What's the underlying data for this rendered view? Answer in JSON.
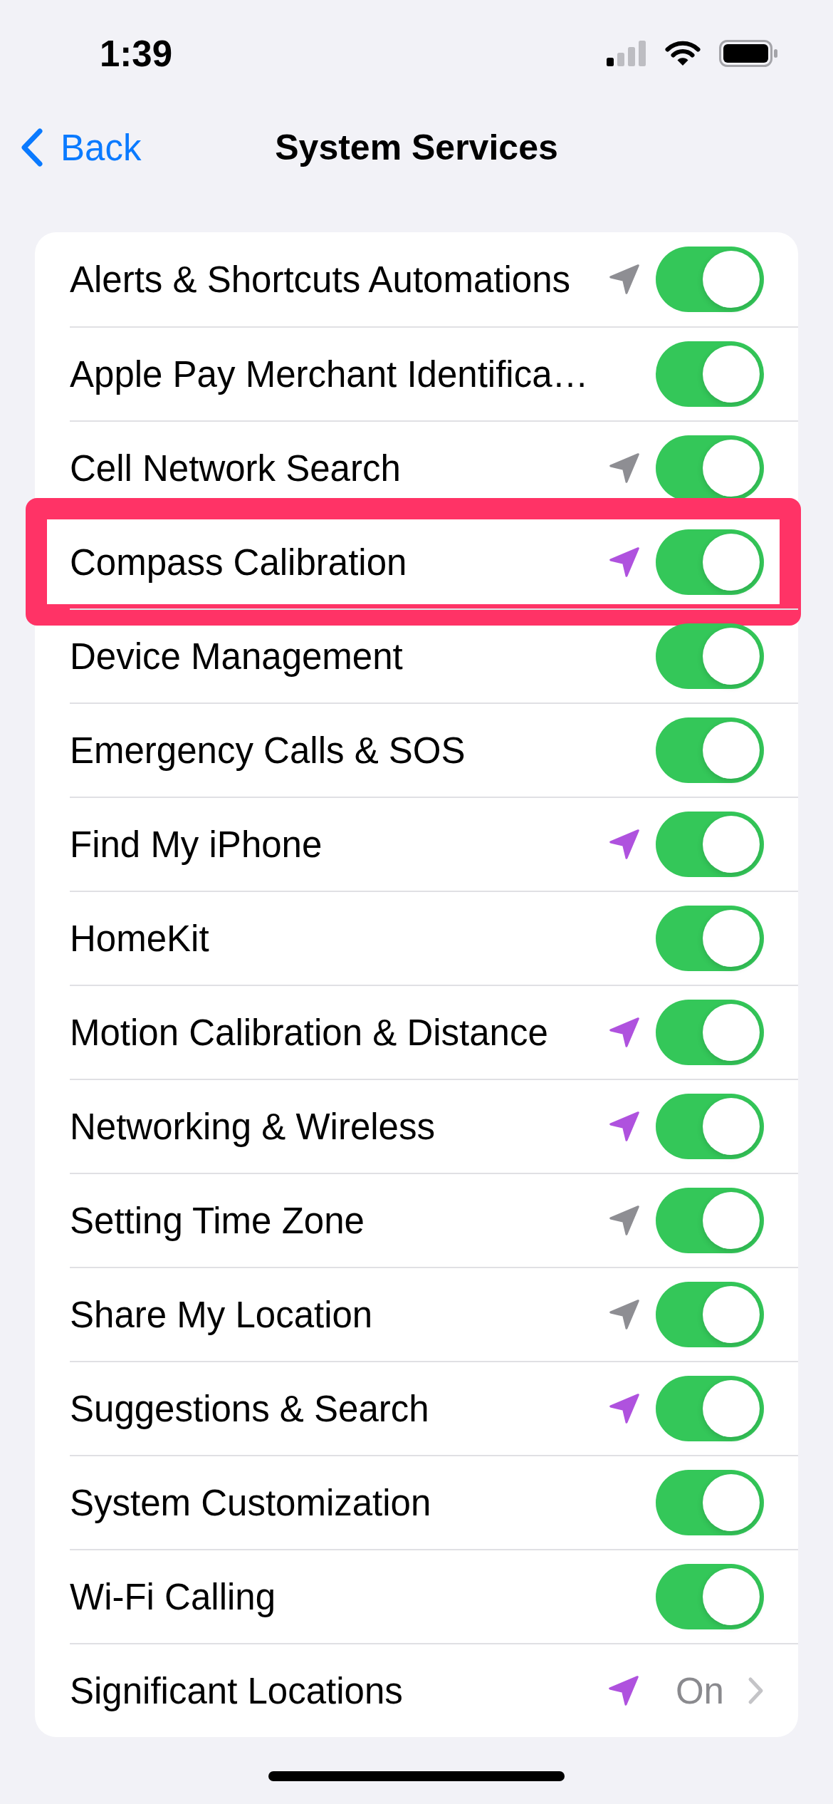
{
  "status_bar": {
    "time": "1:39"
  },
  "nav_bar": {
    "back_label": "Back",
    "title": "System Services"
  },
  "rows": [
    {
      "kind": "toggle",
      "label": "Alerts & Shortcuts Automations",
      "color": "#8e8e93",
      "on": true,
      "highlighted": false
    },
    {
      "kind": "toggle",
      "label": "Apple Pay Merchant Identifica…",
      "on": true,
      "highlighted": false
    },
    {
      "kind": "toggle",
      "label": "Cell Network Search",
      "color": "#8e8e93",
      "on": true,
      "highlighted": false
    },
    {
      "kind": "toggle",
      "label": "Compass Calibration",
      "color": "#af52de",
      "on": true,
      "highlighted": true
    },
    {
      "kind": "toggle",
      "label": "Device Management",
      "on": true,
      "highlighted": false
    },
    {
      "kind": "toggle",
      "label": "Emergency Calls & SOS",
      "on": true,
      "highlighted": false
    },
    {
      "kind": "toggle",
      "label": "Find My iPhone",
      "color": "#af52de",
      "on": true,
      "highlighted": false
    },
    {
      "kind": "toggle",
      "label": "HomeKit",
      "on": true,
      "highlighted": false
    },
    {
      "kind": "toggle",
      "label": "Motion Calibration & Distance",
      "color": "#af52de",
      "on": true,
      "highlighted": false
    },
    {
      "kind": "toggle",
      "label": "Networking & Wireless",
      "color": "#af52de",
      "on": true,
      "highlighted": false
    },
    {
      "kind": "toggle",
      "label": "Setting Time Zone",
      "color": "#8e8e93",
      "on": true,
      "highlighted": false
    },
    {
      "kind": "toggle",
      "label": "Share My Location",
      "color": "#8e8e93",
      "on": true,
      "highlighted": false
    },
    {
      "kind": "toggle",
      "label": "Suggestions & Search",
      "color": "#af52de",
      "on": true,
      "highlighted": false
    },
    {
      "kind": "toggle",
      "label": "System Customization",
      "on": true,
      "highlighted": false
    },
    {
      "kind": "toggle",
      "label": "Wi-Fi Calling",
      "on": true,
      "highlighted": false
    },
    {
      "kind": "link",
      "label": "Significant Locations",
      "color": "#af52de",
      "value": "On",
      "highlighted": false
    }
  ]
}
